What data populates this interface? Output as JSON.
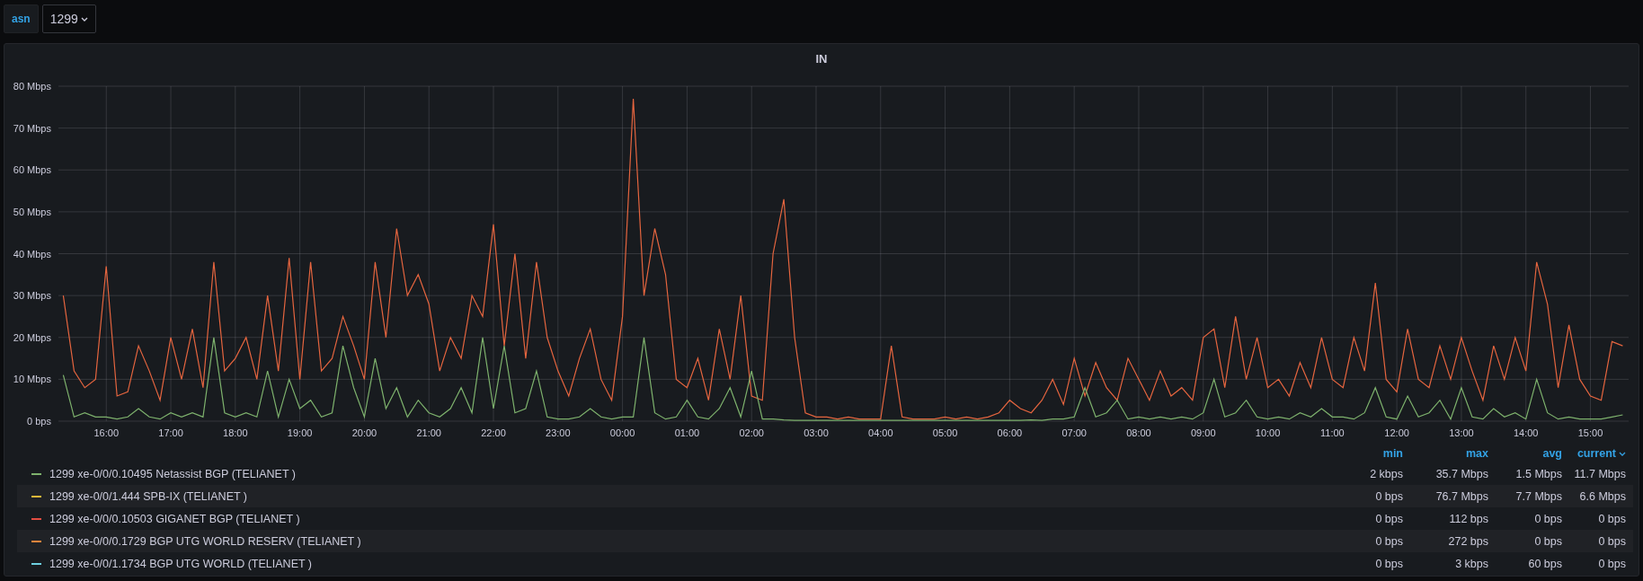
{
  "variable": {
    "label": "asn",
    "value": "1299"
  },
  "panel": {
    "title": "IN",
    "chart_data": {
      "type": "line",
      "ylim": [
        0,
        80
      ],
      "yticks": [
        {
          "value": 0,
          "label": "0 bps"
        },
        {
          "value": 10,
          "label": "10 Mbps"
        },
        {
          "value": 20,
          "label": "20 Mbps"
        },
        {
          "value": 30,
          "label": "30 Mbps"
        },
        {
          "value": 40,
          "label": "40 Mbps"
        },
        {
          "value": 50,
          "label": "50 Mbps"
        },
        {
          "value": 60,
          "label": "60 Mbps"
        },
        {
          "value": 70,
          "label": "70 Mbps"
        },
        {
          "value": 80,
          "label": "80 Mbps"
        }
      ],
      "grid": true,
      "categories": [
        null,
        null,
        null,
        null,
        "16:00",
        null,
        null,
        null,
        null,
        null,
        "17:00",
        null,
        null,
        null,
        null,
        null,
        "18:00",
        null,
        null,
        null,
        null,
        null,
        "19:00",
        null,
        null,
        null,
        null,
        null,
        "20:00",
        null,
        null,
        null,
        null,
        null,
        "21:00",
        null,
        null,
        null,
        null,
        null,
        "22:00",
        null,
        null,
        null,
        null,
        null,
        "23:00",
        null,
        null,
        null,
        null,
        null,
        "00:00",
        null,
        null,
        null,
        null,
        null,
        "01:00",
        null,
        null,
        null,
        null,
        null,
        "02:00",
        null,
        null,
        null,
        null,
        null,
        "03:00",
        null,
        null,
        null,
        null,
        null,
        "04:00",
        null,
        null,
        null,
        null,
        null,
        "05:00",
        null,
        null,
        null,
        null,
        null,
        "06:00",
        null,
        null,
        null,
        null,
        null,
        "07:00",
        null,
        null,
        null,
        null,
        null,
        "08:00",
        null,
        null,
        null,
        null,
        null,
        "09:00",
        null,
        null,
        null,
        null,
        null,
        "10:00",
        null,
        null,
        null,
        null,
        null,
        "11:00",
        null,
        null,
        null,
        null,
        null,
        "12:00",
        null,
        null,
        null,
        null,
        null,
        "13:00",
        null,
        null,
        null,
        null,
        null,
        "14:00",
        null,
        null,
        null,
        null,
        null,
        "15:00",
        null,
        null,
        null
      ],
      "series": [
        {
          "color": "#e5653f",
          "values": [
            30,
            12,
            8,
            10,
            37,
            6,
            7,
            18,
            12,
            5,
            20,
            10,
            22,
            8,
            38,
            12,
            15,
            20,
            10,
            30,
            12,
            39,
            10,
            38,
            12,
            15,
            25,
            18,
            10,
            38,
            20,
            46,
            30,
            35,
            28,
            12,
            20,
            15,
            30,
            25,
            47,
            18,
            40,
            15,
            38,
            20,
            12,
            6,
            15,
            22,
            10,
            5,
            25,
            77,
            30,
            46,
            35,
            10,
            8,
            15,
            5,
            22,
            10,
            30,
            6,
            5,
            40,
            53,
            20,
            2,
            1,
            1,
            0.5,
            1,
            0.5,
            0.5,
            0.5,
            18,
            1,
            0.5,
            0.5,
            0.5,
            1,
            0.5,
            1,
            0.5,
            1,
            2,
            5,
            3,
            2,
            5,
            10,
            4,
            15,
            6,
            14,
            8,
            5,
            15,
            10,
            5,
            12,
            6,
            8,
            5,
            20,
            22,
            8,
            25,
            10,
            20,
            8,
            10,
            6,
            14,
            8,
            20,
            10,
            8,
            20,
            12,
            33,
            10,
            7,
            22,
            10,
            8,
            18,
            10,
            20,
            12,
            5,
            18,
            10,
            20,
            12,
            38,
            28,
            8,
            23,
            10,
            6,
            5,
            19,
            18
          ]
        },
        {
          "color": "#7eb26d",
          "values": [
            11,
            1,
            2,
            1,
            1,
            0.5,
            1,
            3,
            1,
            0.5,
            2,
            1,
            2,
            1,
            20,
            2,
            1,
            2,
            1,
            12,
            1,
            10,
            3,
            5,
            1,
            2,
            18,
            8,
            1,
            15,
            3,
            8,
            1,
            5,
            2,
            1,
            3,
            8,
            2,
            20,
            3,
            18,
            2,
            3,
            12,
            1,
            0.5,
            0.5,
            1,
            3,
            1,
            0.5,
            1,
            1,
            20,
            2,
            0.5,
            1,
            5,
            1,
            0.5,
            3,
            8,
            1,
            12,
            0.5,
            0.5,
            0.3,
            0.2,
            0.2,
            0.2,
            0.2,
            0.2,
            0.2,
            0.2,
            0.2,
            0.2,
            0.2,
            0.2,
            0.2,
            0.2,
            0.2,
            0.2,
            0.2,
            0.2,
            0.2,
            0.2,
            0.2,
            0.2,
            0.2,
            0.3,
            0.2,
            0.5,
            0.5,
            1,
            8,
            1,
            2,
            5,
            0.5,
            1,
            0.5,
            1,
            0.5,
            1,
            0.5,
            2,
            10,
            1,
            2,
            5,
            1,
            0.5,
            1,
            0.5,
            2,
            1,
            3,
            1,
            1,
            0.5,
            2,
            8,
            1,
            0.5,
            6,
            1,
            2,
            5,
            0.5,
            8,
            1,
            0.5,
            3,
            1,
            2,
            0.5,
            10,
            2,
            0.5,
            1,
            0.5,
            0.5,
            0.5,
            1,
            1.5
          ]
        }
      ]
    },
    "legend": {
      "columns": [
        {
          "label": "min",
          "sorted": false
        },
        {
          "label": "max",
          "sorted": false
        },
        {
          "label": "avg",
          "sorted": false
        },
        {
          "label": "current",
          "sorted": true
        }
      ],
      "rows": [
        {
          "label": "1299 xe-0/0/0.10495 Netassist BGP (TELIANET )",
          "color": "#7eb26d",
          "values": [
            "2 kbps",
            "35.7 Mbps",
            "1.5 Mbps",
            "11.7 Mbps"
          ]
        },
        {
          "label": "1299 xe-0/0/1.444 SPB-IX (TELIANET )",
          "color": "#eab839",
          "values": [
            "0 bps",
            "76.7 Mbps",
            "7.7 Mbps",
            "6.6 Mbps"
          ]
        },
        {
          "label": "1299 xe-0/0/0.10503 GIGANET BGP (TELIANET )",
          "color": "#e24d42",
          "values": [
            "0 bps",
            "112 bps",
            "0 bps",
            "0 bps"
          ]
        },
        {
          "label": "1299 xe-0/0/0.1729 BGP UTG WORLD RESERV (TELIANET )",
          "color": "#ef843c",
          "values": [
            "0 bps",
            "272 bps",
            "0 bps",
            "0 bps"
          ]
        },
        {
          "label": "1299 xe-0/0/1.1734 BGP UTG WORLD (TELIANET )",
          "color": "#6ed0e0",
          "values": [
            "0 bps",
            "3 kbps",
            "60 bps",
            "0 bps"
          ]
        }
      ]
    }
  }
}
